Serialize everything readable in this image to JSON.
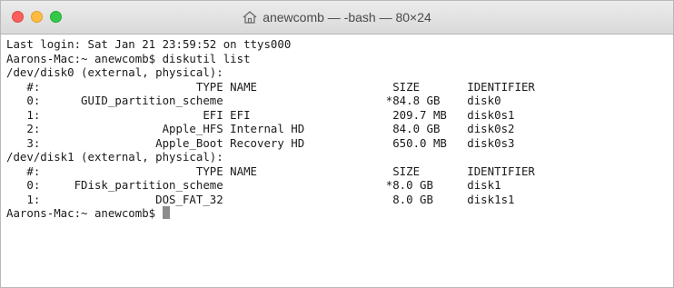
{
  "window": {
    "title": "anewcomb — -bash — 80×24",
    "title_icon": "home-icon"
  },
  "terminal": {
    "lines": [
      "Last login: Sat Jan 21 23:59:52 on ttys000",
      "Aarons-Mac:~ anewcomb$ diskutil list",
      "/dev/disk0 (external, physical):",
      "   #:                       TYPE NAME                    SIZE       IDENTIFIER",
      "   0:      GUID_partition_scheme                        *84.8 GB    disk0",
      "   1:                        EFI EFI                     209.7 MB   disk0s1",
      "   2:                  Apple_HFS Internal HD             84.0 GB    disk0s2",
      "   3:                 Apple_Boot Recovery HD             650.0 MB   disk0s3",
      "/dev/disk1 (external, physical):",
      "   #:                       TYPE NAME                    SIZE       IDENTIFIER",
      "   0:     FDisk_partition_scheme                        *8.0 GB     disk1",
      "   1:                 DOS_FAT_32                         8.0 GB     disk1s1"
    ],
    "prompt": "Aarons-Mac:~ anewcomb$ "
  },
  "colors": {
    "close": "#fc605c",
    "minimize": "#fdbc40",
    "maximize": "#34c84a",
    "cursor": "#8c8c8c"
  }
}
